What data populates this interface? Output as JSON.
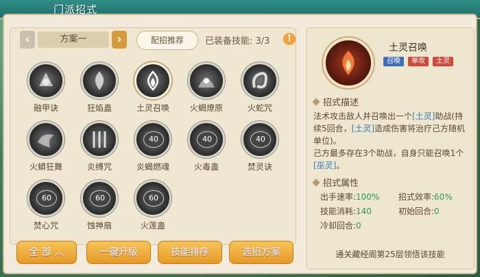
{
  "header": {
    "title": "门派招式"
  },
  "toolbar": {
    "plan_label": "方案一",
    "prev_glyph": "‹",
    "next_glyph": "›",
    "recommend_label": "配招推荐",
    "equipped_text": "已装备技能: 3/3",
    "warn_glyph": "!"
  },
  "skills": [
    {
      "name": "融甲诀",
      "level": null
    },
    {
      "name": "狂焰蛊",
      "level": null
    },
    {
      "name": "土灵召唤",
      "level": null
    },
    {
      "name": "火蝎燎原",
      "level": null
    },
    {
      "name": "火蛇咒",
      "level": null
    },
    {
      "name": "火蟒狂舞",
      "level": null
    },
    {
      "name": "炎缚咒",
      "level": null
    },
    {
      "name": "炎蝎燃魂",
      "level": "40"
    },
    {
      "name": "火毒蛊",
      "level": "40"
    },
    {
      "name": "焚灵诀",
      "level": "40"
    },
    {
      "name": "焚心咒",
      "level": "60"
    },
    {
      "name": "蚀神扇",
      "level": "60"
    },
    {
      "name": "火莲蛊",
      "level": "60"
    }
  ],
  "buttons": {
    "all": "全 部",
    "all_glyph": "︿",
    "upgrade": "一键升级",
    "sort": "技能排序",
    "choose": "选招方案"
  },
  "detail": {
    "title": "土灵召唤",
    "tags": [
      {
        "label": "召唤",
        "color": "#3d6fb8"
      },
      {
        "label": "单攻",
        "color": "#d14b3a"
      },
      {
        "label": "土灵",
        "color": "#d14b3a"
      }
    ],
    "desc_heading": "招式描述",
    "desc_parts": {
      "p1": "法术攻击敌人并召唤出一个",
      "h1": "[土灵]",
      "p2": "助战(持续5回合，",
      "h2": "[土灵]",
      "p3": "造成伤害将治疗己方随机单位)。",
      "p4": "己方最多存在3个助战，自身只能召唤1个",
      "h3": "[巫灵]",
      "p5": "。"
    },
    "attr_heading": "招式属性",
    "attrs": {
      "speed_label": "出手速率:",
      "speed_value": "100%",
      "eff_label": "招式效率:",
      "eff_value": "60%",
      "cost_label": "技能消耗:",
      "cost_value": "140",
      "init_label": "初始回合:",
      "init_value": "0",
      "cd_label": "冷却回合:",
      "cd_value": "0"
    },
    "footer": "通关藏经阁第25层领悟该技能"
  },
  "colors": {
    "accent": "#e79a27",
    "highlight": "#2f7fbf",
    "value": "#2f9a4a"
  }
}
